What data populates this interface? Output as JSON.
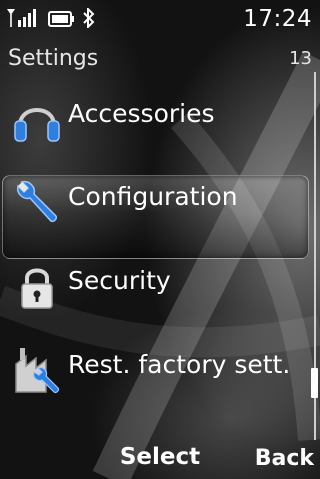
{
  "status": {
    "time": "17:24",
    "icons": [
      "signal-icon",
      "battery-icon",
      "bluetooth-icon"
    ]
  },
  "header": {
    "title": "Settings",
    "count": "13"
  },
  "menu": {
    "items": [
      {
        "label": "Accessories",
        "icon": "headphones-icon"
      },
      {
        "label": "Configuration",
        "icon": "wrench-icon",
        "selected": true
      },
      {
        "label": "Security",
        "icon": "padlock-icon"
      },
      {
        "label": "Rest. factory sett.",
        "icon": "factory-reset-icon"
      }
    ]
  },
  "softkeys": {
    "left": "",
    "middle": "Select",
    "right": "Back"
  },
  "colors": {
    "background": "#121212",
    "text": "#ffffff",
    "icon_blue": "#2f7fe0"
  }
}
